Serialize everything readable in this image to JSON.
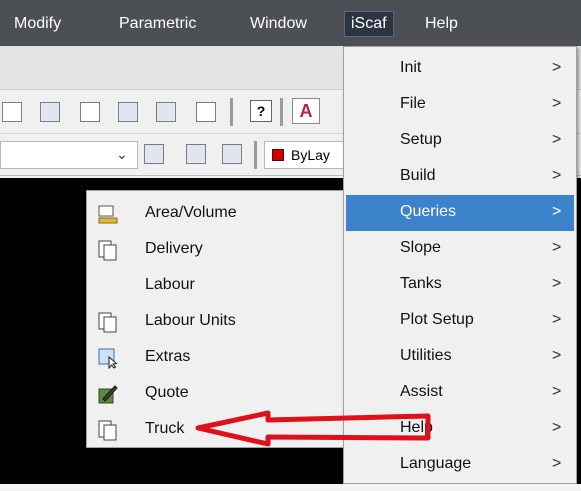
{
  "menubar": {
    "items": [
      {
        "label": "Modify"
      },
      {
        "label": "Parametric"
      },
      {
        "label": "Window"
      },
      {
        "label": "iScaf"
      },
      {
        "label": "Help"
      }
    ]
  },
  "toolbar": {
    "help_symbol": "?",
    "text_symbol": "A",
    "dropdown_symbol": "⌄",
    "color_value": "ByLay",
    "color_swatch": "#d00000"
  },
  "iscaf_menu": {
    "items": [
      {
        "label": "Init",
        "arrow": ">"
      },
      {
        "label": "File",
        "arrow": ">"
      },
      {
        "label": "Setup",
        "arrow": ">"
      },
      {
        "label": "Build",
        "arrow": ">"
      },
      {
        "label": "Queries",
        "arrow": ">",
        "highlighted": true
      },
      {
        "label": "Slope",
        "arrow": ">"
      },
      {
        "label": "Tanks",
        "arrow": ">"
      },
      {
        "label": "Plot Setup",
        "arrow": ">"
      },
      {
        "label": "Utilities",
        "arrow": ">"
      },
      {
        "label": "Assist",
        "arrow": ">"
      },
      {
        "label": "Help",
        "arrow": ">"
      },
      {
        "label": "Language",
        "arrow": ">"
      }
    ],
    "highlight_color": "#3d83cc"
  },
  "queries_submenu": {
    "items": [
      {
        "label": "Area/Volume",
        "icon": "area-volume-icon"
      },
      {
        "label": "Delivery",
        "icon": "document-icon"
      },
      {
        "label": "Labour",
        "icon": ""
      },
      {
        "label": "Labour Units",
        "icon": "document-icon"
      },
      {
        "label": "Extras",
        "icon": "extras-cursor-icon"
      },
      {
        "label": "Quote",
        "icon": "quote-pen-icon"
      },
      {
        "label": "Truck",
        "icon": "document-icon"
      }
    ]
  },
  "annotation": {
    "type": "red-arrow",
    "color": "#e0101a",
    "points_to": "Truck"
  }
}
